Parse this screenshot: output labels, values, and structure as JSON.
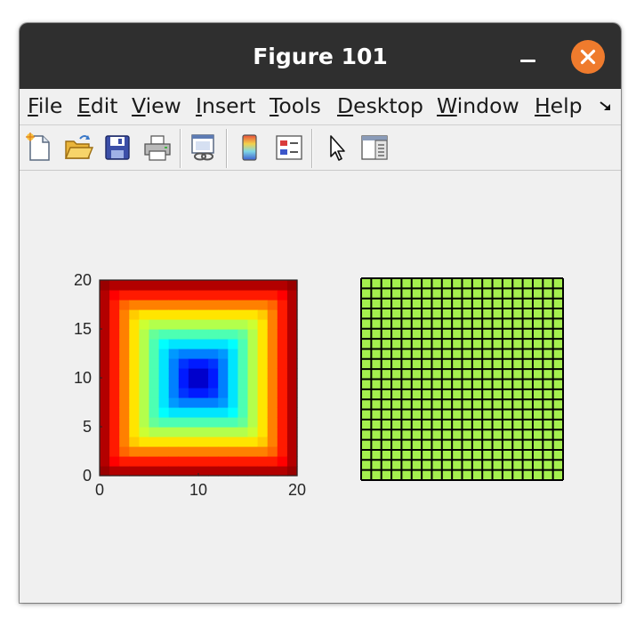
{
  "window": {
    "title": "Figure 101"
  },
  "menubar": {
    "items": [
      {
        "label": "File",
        "mnemonic": "F",
        "rest": "ile"
      },
      {
        "label": "Edit",
        "mnemonic": "E",
        "rest": "dit"
      },
      {
        "label": "View",
        "mnemonic": "V",
        "rest": "iew"
      },
      {
        "label": "Insert",
        "mnemonic": "I",
        "rest": "nsert"
      },
      {
        "label": "Tools",
        "mnemonic": "T",
        "rest": "ools"
      },
      {
        "label": "Desktop",
        "mnemonic": "D",
        "rest": "esktop"
      },
      {
        "label": "Window",
        "mnemonic": "W",
        "rest": "indow"
      },
      {
        "label": "Help",
        "mnemonic": "H",
        "rest": "elp"
      }
    ],
    "overflow_icon": "expand-arrow-icon"
  },
  "toolbar": {
    "buttons": [
      {
        "icon": "new-figure-icon"
      },
      {
        "icon": "open-file-icon"
      },
      {
        "icon": "save-icon"
      },
      {
        "icon": "print-icon"
      },
      {
        "icon": "link-plot-icon"
      },
      {
        "icon": "insert-colorbar-icon"
      },
      {
        "icon": "insert-legend-icon"
      },
      {
        "icon": "edit-plot-pointer-icon"
      },
      {
        "icon": "property-inspector-icon"
      }
    ]
  },
  "chart_data": [
    {
      "type": "heatmap",
      "description_values": "z = max(|x-10|, |y-10|) over a 21x21 grid, x and y from 0 to 20",
      "grid_size": [
        21,
        21
      ],
      "x_range": [
        0,
        20
      ],
      "y_range": [
        0,
        20
      ],
      "z_range": [
        0,
        10
      ],
      "colormap": "jet",
      "xticks": [
        "0",
        "10",
        "20"
      ],
      "yticks": [
        "0",
        "5",
        "10",
        "15",
        "20"
      ],
      "title": "",
      "xlabel": "",
      "ylabel": ""
    },
    {
      "type": "heatmap",
      "description_values": "uniform grid of 20x20 cells, all same value",
      "grid_size": [
        20,
        20
      ],
      "cell_color": "#a4ef4e",
      "edge_color": "#000000",
      "axes_visible": false,
      "title": "",
      "xlabel": "",
      "ylabel": ""
    }
  ]
}
